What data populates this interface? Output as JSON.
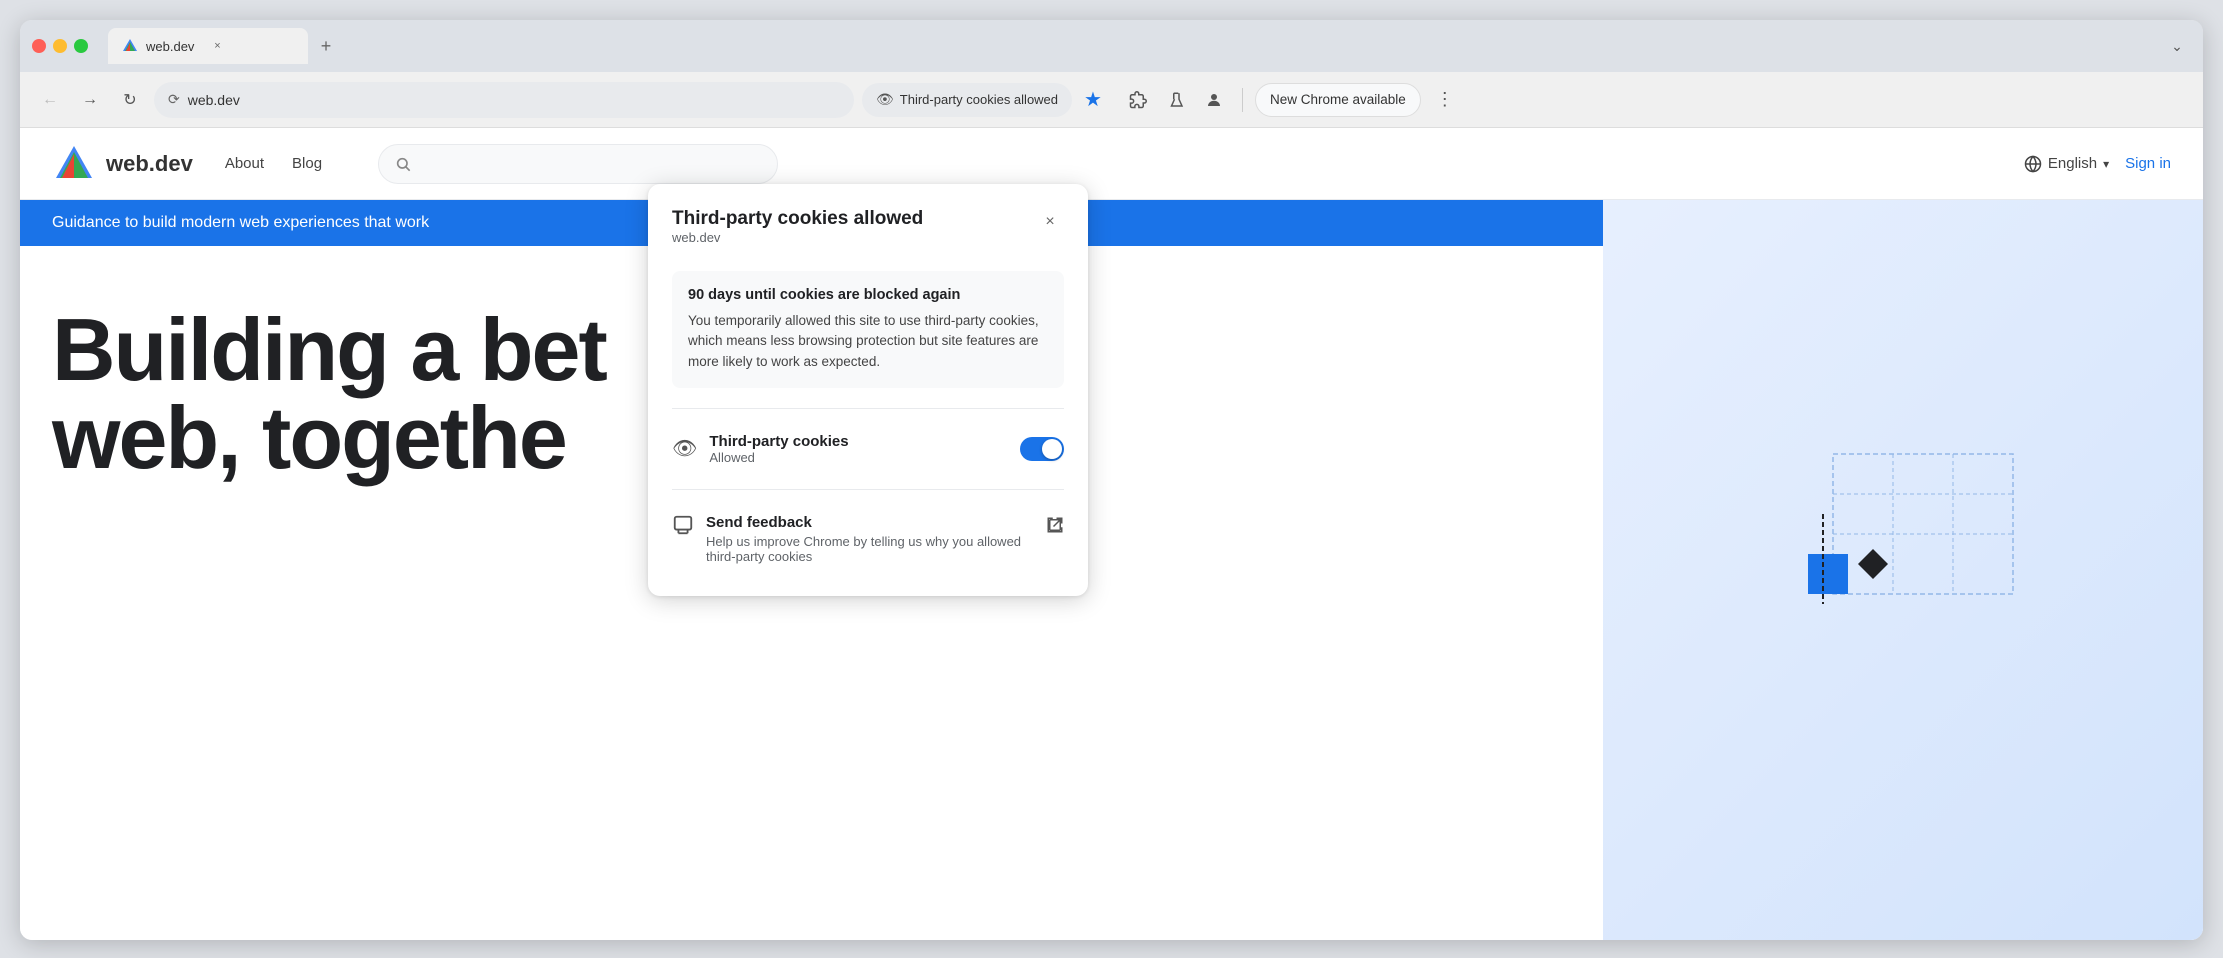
{
  "browser": {
    "tab": {
      "title": "web.dev",
      "favicon": "▶"
    },
    "new_tab_icon": "+",
    "chevron_icon": "⌄",
    "address": "web.dev",
    "back_btn": "←",
    "forward_btn": "→",
    "reload_btn": "↻",
    "cookies_pill_label": "Third-party cookies allowed",
    "star_icon": "★",
    "extensions_icon": "⬡",
    "flask_icon": "⚗",
    "person_icon": "👤",
    "new_chrome_label": "New Chrome available",
    "more_icon": "⋮",
    "tab_close": "×"
  },
  "site": {
    "logo_text": "web.dev",
    "nav_items": [
      "About",
      "Blog"
    ],
    "lang_label": "English",
    "sign_in_label": "Sign in",
    "banner_text": "Guidance to build modern web experiences that work",
    "hero_line1": "Building a bet",
    "hero_line2": "web, togethe"
  },
  "popup": {
    "title": "Third-party cookies allowed",
    "url": "web.dev",
    "close_icon": "×",
    "warning_title": "90 days until cookies are blocked again",
    "warning_text": "You temporarily allowed this site to use third-party cookies, which means less browsing protection but site features are more likely to work as expected.",
    "cookies_row_label": "Third-party cookies",
    "cookies_row_sub": "Allowed",
    "cookies_eye_icon": "◉",
    "feedback_label": "Send feedback",
    "feedback_sub": "Help us improve Chrome by telling us why you allowed third-party cookies",
    "feedback_icon": "💬",
    "external_icon": "⬡"
  },
  "colors": {
    "accent_blue": "#1a73e8",
    "title_bar": "#dde1e7",
    "tab_bg": "#f0f0f0",
    "pill_bg": "#e8eaed"
  }
}
